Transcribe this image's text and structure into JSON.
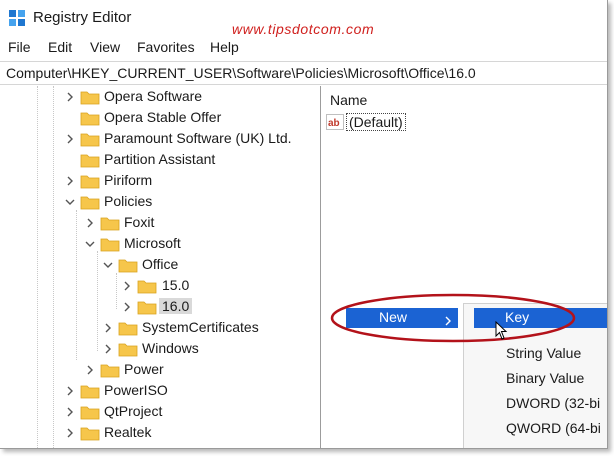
{
  "window": {
    "title": "Registry Editor",
    "watermark": "www.tipsdotcom.com"
  },
  "menu": [
    "File",
    "Edit",
    "View",
    "Favorites",
    "Help"
  ],
  "address": "Computer\\HKEY_CURRENT_USER\\Software\\Policies\\Microsoft\\Office\\16.0",
  "tree": {
    "nodes": [
      {
        "label": "Opera Software",
        "chevron": "right"
      },
      {
        "label": "Opera Stable Offer",
        "chevron": "none"
      },
      {
        "label": "Paramount Software (UK) Ltd.",
        "chevron": "right"
      },
      {
        "label": "Partition Assistant",
        "chevron": "none"
      },
      {
        "label": "Piriform",
        "chevron": "right"
      },
      {
        "label": "Policies",
        "chevron": "down"
      },
      {
        "label": "Foxit",
        "chevron": "right"
      },
      {
        "label": "Microsoft",
        "chevron": "down"
      },
      {
        "label": "Office",
        "chevron": "down"
      },
      {
        "label": "15.0",
        "chevron": "right"
      },
      {
        "label": "16.0",
        "chevron": "right",
        "selected": true
      },
      {
        "label": "SystemCertificates",
        "chevron": "right"
      },
      {
        "label": "Windows",
        "chevron": "right"
      },
      {
        "label": "Power",
        "chevron": "right"
      },
      {
        "label": "PowerISO",
        "chevron": "right"
      },
      {
        "label": "QtProject",
        "chevron": "right"
      },
      {
        "label": "Realtek",
        "chevron": "right"
      }
    ]
  },
  "values_pane": {
    "column_name": "Name",
    "rows": [
      {
        "name": "(Default)",
        "icon": "string-value-icon"
      }
    ]
  },
  "context_menu": {
    "new_label": "New",
    "new_arrow": ">",
    "submenu": {
      "items": [
        "Key",
        "String Value",
        "Binary Value",
        "DWORD (32-bi",
        "QWORD (64-bi"
      ],
      "highlighted": "Key"
    }
  },
  "colors": {
    "highlight": "#1b63d3",
    "annotation": "#b3121a",
    "watermark": "#d0201e",
    "folder": "#f6c64b"
  }
}
